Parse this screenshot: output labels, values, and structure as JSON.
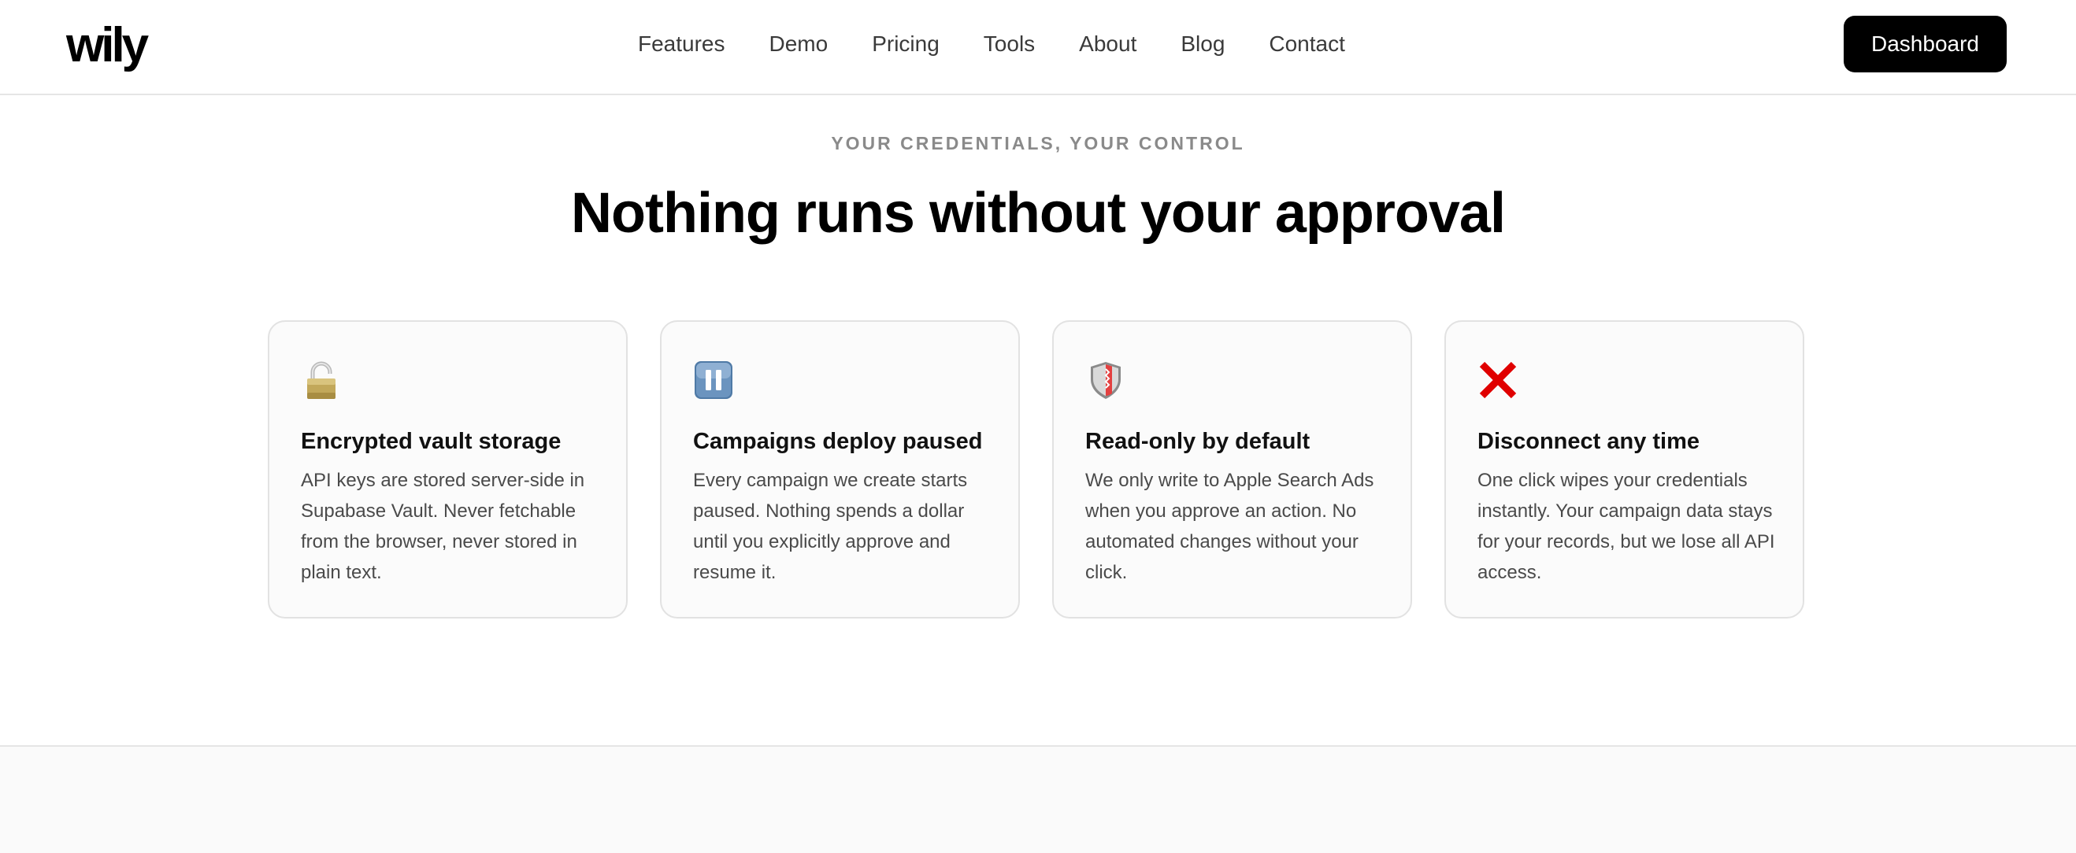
{
  "header": {
    "logo": "wily",
    "nav": [
      "Features",
      "Demo",
      "Pricing",
      "Tools",
      "About",
      "Blog",
      "Contact"
    ],
    "dashboard_label": "Dashboard"
  },
  "hero": {
    "eyebrow": "YOUR CREDENTIALS, YOUR CONTROL",
    "headline": "Nothing runs without your approval"
  },
  "cards": [
    {
      "icon": "lock-icon",
      "title": "Encrypted vault storage",
      "description": "API keys are stored server-side in Supabase Vault. Never fetchable from the browser, never stored in plain text."
    },
    {
      "icon": "pause-icon",
      "title": "Campaigns deploy paused",
      "description": "Every campaign we create starts paused. Nothing spends a dollar until you explicitly approve and resume it."
    },
    {
      "icon": "shield-icon",
      "title": "Read-only by default",
      "description": "We only write to Apple Search Ads when you approve an action. No automated changes without your click."
    },
    {
      "icon": "cross-mark-icon",
      "title": "Disconnect any time",
      "description": "One click wipes your credentials instantly. Your campaign data stays for your records, but we lose all API access."
    }
  ],
  "colors": {
    "primary_button": "#000000",
    "card_background": "#fbfbfb",
    "card_border": "#e2e2e2",
    "cross_mark": "#e00000"
  }
}
